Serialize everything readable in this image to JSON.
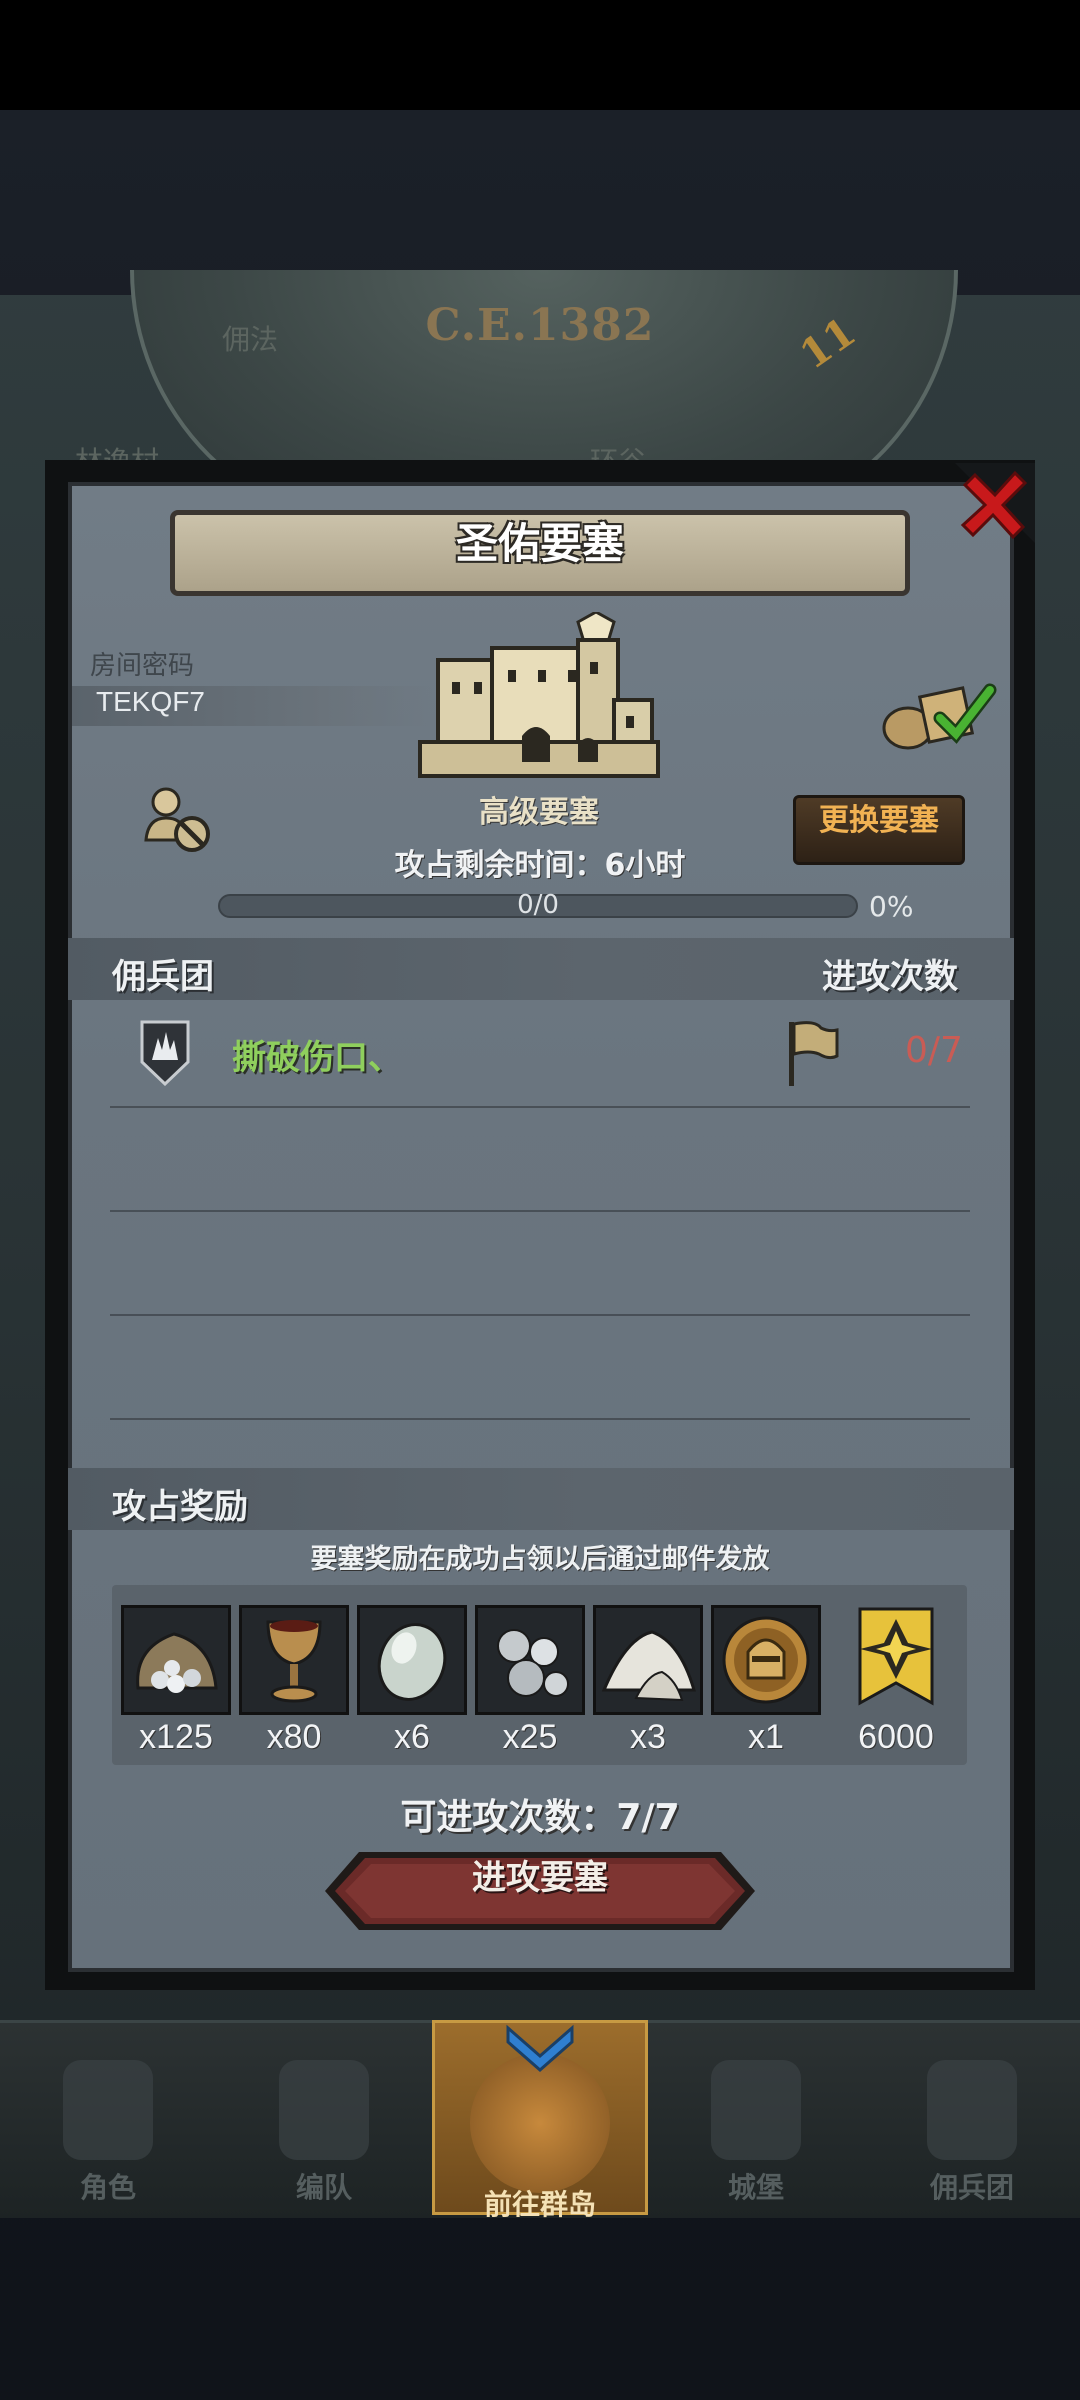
{
  "background": {
    "era": "C.E.1382",
    "compass_number": "11",
    "bg_texts": [
      "佣法",
      "林逸村",
      "环谷"
    ]
  },
  "dialog": {
    "title": "圣佑要塞",
    "room_code_label": "房间密码",
    "room_code": "TEKQF7",
    "fortress_tier": "高级要塞",
    "swap_button": "更换要塞",
    "occupation_time": "攻占剩余时间：6小时",
    "progress": {
      "text": "0/0",
      "percent_text": "0%",
      "fraction": 0
    },
    "mercenary_header": "佣兵团",
    "attacks_header": "进攻次数",
    "mercenaries": [
      {
        "name": "撕破伤口、",
        "attacks": "0/7"
      }
    ],
    "reward_header": "攻占奖励",
    "reward_note": "要塞奖励在成功占领以后通过邮件发放",
    "rewards": [
      {
        "icon": "silver-coins-bag-icon",
        "qty": "x125"
      },
      {
        "icon": "goblet-icon",
        "qty": "x80"
      },
      {
        "icon": "white-stone-icon",
        "qty": "x6"
      },
      {
        "icon": "silver-pearls-icon",
        "qty": "x25"
      },
      {
        "icon": "salt-pile-icon",
        "qty": "x3"
      },
      {
        "icon": "knight-helmet-medal-icon",
        "qty": "x1"
      },
      {
        "icon": "gold-rank-banner-icon",
        "qty": "6000"
      }
    ],
    "remaining_attacks": "可进攻次数：7/7",
    "attack_button": "进攻要塞"
  },
  "bottom_nav": [
    {
      "label": "角色",
      "icon": "character-icon"
    },
    {
      "label": "编队",
      "icon": "formation-icon"
    },
    {
      "label": "前往群岛",
      "icon": "islands-globe-icon",
      "active": true
    },
    {
      "label": "城堡",
      "icon": "castle-icon"
    },
    {
      "label": "佣兵团",
      "icon": "mercenary-icon"
    }
  ],
  "colors": {
    "panel_bg": "#6a757f",
    "merc_name": "#8fcf5d",
    "attack_count": "#c95c55",
    "swap_text": "#f1b253",
    "attack_button": "#6b2a28",
    "close_red": "#c8191b"
  }
}
